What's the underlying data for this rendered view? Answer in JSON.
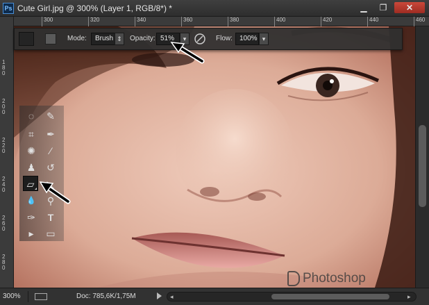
{
  "app": {
    "logo": "Ps",
    "document_title": "Cute Girl.jpg @ 300% (Layer 1, RGB/8*) *"
  },
  "window_controls": {
    "minimize": "▁",
    "maximize": "❐",
    "close": "✕"
  },
  "rulers": {
    "top_ticks": [
      "300",
      "320",
      "340",
      "360",
      "380",
      "400",
      "420",
      "440",
      "460"
    ],
    "left_ticks": [
      "180",
      "200",
      "220",
      "240",
      "260",
      "280"
    ]
  },
  "options_bar": {
    "mode_label": "Mode:",
    "mode_value": "Brush",
    "opacity_label": "Opacity:",
    "opacity_value": "51%",
    "flow_label": "Flow:",
    "flow_value": "100%",
    "dropdown_glyph": "▾",
    "spinner_glyph": "⇕"
  },
  "tools": [
    {
      "name": "lasso-tool-icon",
      "glyph": "◌"
    },
    {
      "name": "quick-select-tool-icon",
      "glyph": "✎"
    },
    {
      "name": "crop-tool-icon",
      "glyph": "⌗"
    },
    {
      "name": "eyedropper-tool-icon",
      "glyph": "✒"
    },
    {
      "name": "spot-healing-tool-icon",
      "glyph": "✺"
    },
    {
      "name": "brush-tool-icon",
      "glyph": "⁄"
    },
    {
      "name": "clone-stamp-tool-icon",
      "glyph": "♟"
    },
    {
      "name": "history-brush-tool-icon",
      "glyph": "↺"
    },
    {
      "name": "eraser-tool-icon",
      "glyph": "▱"
    },
    {
      "name": "paint-bucket-tool-icon",
      "glyph": "◣"
    },
    {
      "name": "blur-tool-icon",
      "glyph": "💧"
    },
    {
      "name": "dodge-tool-icon",
      "glyph": "⚲"
    },
    {
      "name": "pen-tool-icon",
      "glyph": "✑"
    },
    {
      "name": "type-tool-icon",
      "glyph": "T"
    },
    {
      "name": "path-select-tool-icon",
      "glyph": "▸"
    },
    {
      "name": "rectangle-tool-icon",
      "glyph": "▭"
    }
  ],
  "active_tool": "eraser-tool-icon",
  "watermark": "Photoshop",
  "status_bar": {
    "zoom": "300%",
    "doc_info": "Doc: 785,6K/1,75M",
    "left_arrow": "◂",
    "right_arrow": "▸"
  },
  "colors": {
    "ui_dark": "#2a2a2a",
    "close_button": "#b53a2e",
    "skin": "#d9a995"
  }
}
